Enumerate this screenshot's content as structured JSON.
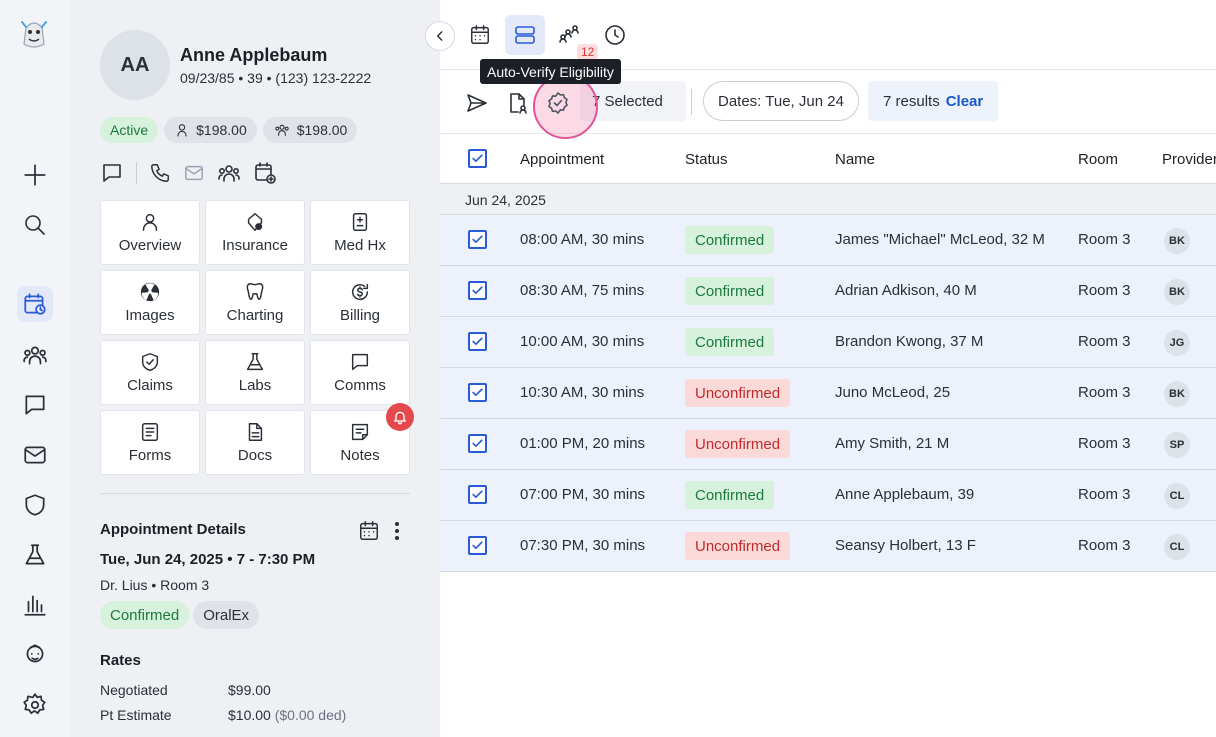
{
  "patient": {
    "initials": "AA",
    "name": "Anne Applebaum",
    "meta": "09/23/85 • 39 • (123) 123-2222",
    "status": "Active",
    "balance_patient": "$198.00",
    "balance_family": "$198.00"
  },
  "tiles": [
    {
      "label": "Overview",
      "icon": "person-icon"
    },
    {
      "label": "Insurance",
      "icon": "insurance-shield-icon"
    },
    {
      "label": "Med Hx",
      "icon": "medical-history-icon"
    },
    {
      "label": "Images",
      "icon": "radiation-icon"
    },
    {
      "label": "Charting",
      "icon": "tooth-icon"
    },
    {
      "label": "Billing",
      "icon": "billing-dollar-icon"
    },
    {
      "label": "Claims",
      "icon": "shield-check-icon"
    },
    {
      "label": "Labs",
      "icon": "flask-icon"
    },
    {
      "label": "Comms",
      "icon": "chat-icon"
    },
    {
      "label": "Forms",
      "icon": "form-icon"
    },
    {
      "label": "Docs",
      "icon": "document-icon"
    },
    {
      "label": "Notes",
      "icon": "note-icon"
    }
  ],
  "appointment": {
    "heading": "Appointment Details",
    "date": "Tue, Jun 24, 2025 • 7 - 7:30 PM",
    "provider_room": "Dr. Lius • Room 3",
    "status": "Confirmed",
    "type": "OralEx"
  },
  "rates": {
    "heading": "Rates",
    "negotiated_label": "Negotiated",
    "negotiated_value": "$99.00",
    "estimate_label": "Pt Estimate",
    "estimate_value": "$10.00",
    "estimate_note": "($0.00 ded)"
  },
  "topbar": {
    "badge_count": "12",
    "tooltip": "Auto-Verify Eligibility"
  },
  "actionbar": {
    "selected": "7 Selected",
    "dates_filter": "Dates: Tue, Jun 24",
    "results": "7 results",
    "clear": "Clear"
  },
  "table": {
    "columns": {
      "appointment": "Appointment",
      "status": "Status",
      "name": "Name",
      "room": "Room",
      "provider": "Provider"
    },
    "group_label": "Jun 24, 2025",
    "rows": [
      {
        "time": "08:00 AM, 30 mins",
        "status": "Confirmed",
        "name": "James \"Michael\" McLeod, 32 M",
        "room": "Room 3",
        "provider": "BK"
      },
      {
        "time": "08:30 AM, 75 mins",
        "status": "Confirmed",
        "name": "Adrian Adkison, 40 M",
        "room": "Room 3",
        "provider": "BK"
      },
      {
        "time": "10:00 AM, 30 mins",
        "status": "Confirmed",
        "name": "Brandon Kwong, 37 M",
        "room": "Room 3",
        "provider": "JG"
      },
      {
        "time": "10:30 AM, 30 mins",
        "status": "Unconfirmed",
        "name": "Juno McLeod, 25",
        "room": "Room 3",
        "provider": "BK"
      },
      {
        "time": "01:00 PM, 20 mins",
        "status": "Unconfirmed",
        "name": "Amy Smith, 21 M",
        "room": "Room 3",
        "provider": "SP"
      },
      {
        "time": "07:00 PM, 30 mins",
        "status": "Confirmed",
        "name": "Anne Applebaum, 39",
        "room": "Room 3",
        "provider": "CL"
      },
      {
        "time": "07:30 PM, 30 mins",
        "status": "Unconfirmed",
        "name": "Seansy Holbert, 13 F",
        "room": "Room 3",
        "provider": "CL"
      }
    ]
  },
  "colors": {
    "accent": "#2a5bd7",
    "confirmed_bg": "#d6f1dc",
    "confirmed_text": "#1c7a3c",
    "unconfirmed_bg": "#fbd9d9",
    "unconfirmed_text": "#c12b2b"
  }
}
